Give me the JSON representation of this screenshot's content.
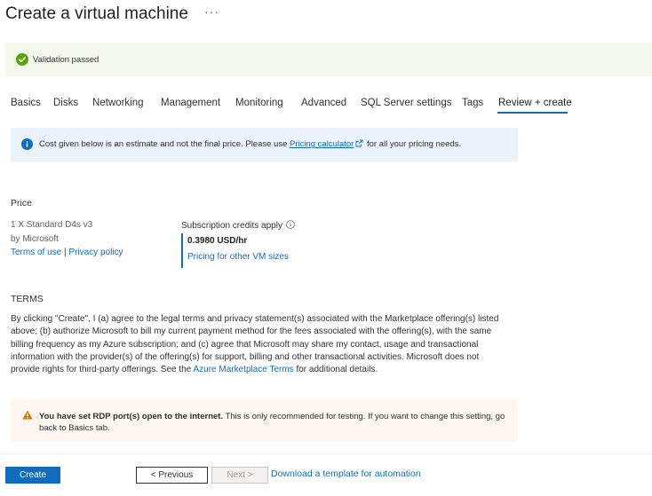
{
  "header": {
    "title": "Create a virtual machine",
    "more": "···"
  },
  "validation": {
    "text": "Validation passed"
  },
  "tabs": [
    {
      "label": "Basics"
    },
    {
      "label": "Disks"
    },
    {
      "label": "Networking"
    },
    {
      "label": "Management"
    },
    {
      "label": "Monitoring"
    },
    {
      "label": "Advanced"
    },
    {
      "label": "SQL Server settings"
    },
    {
      "label": "Tags"
    },
    {
      "label": "Review + create"
    }
  ],
  "info": {
    "prefix": "Cost given below is an estimate and not the final price. Please use ",
    "link": "Pricing calculator",
    "suffix": " for all your pricing needs."
  },
  "price": {
    "heading": "Price",
    "product": "1 X Standard D4s v3",
    "publisher": "by Microsoft",
    "terms_of_use": "Terms of use",
    "separator": "|",
    "privacy_policy": "Privacy policy",
    "credits_label": "Subscription credits apply",
    "value": "0.3980 USD/hr",
    "other_sizes_link": "Pricing for other VM sizes"
  },
  "terms": {
    "heading": "TERMS",
    "body": "By clicking \"Create\", I (a) agree to the legal terms and privacy statement(s) associated with the Marketplace offering(s) listed above; (b) authorize Microsoft to bill my current payment method for the fees associated with the offering(s), with the same billing frequency as my Azure subscription; and (c) agree that Microsoft may share my contact, usage and transactional information with the provider(s) of the offering(s) for support, billing and other transactional activities. Microsoft does not provide rights for third-party offerings. See the ",
    "link": "Azure Marketplace Terms",
    "suffix": " for additional details."
  },
  "warning": {
    "bold": "You have set RDP port(s) open to the internet.",
    "text": "  This is only recommended for testing.  If you want to change this setting, go back to Basics tab."
  },
  "footer": {
    "create": "Create",
    "previous": "< Previous",
    "next": "Next >",
    "download": "Download a template for automation"
  },
  "colors": {
    "accent": "#0f6cbd",
    "success": "#57a300",
    "warning": "#d47500"
  }
}
